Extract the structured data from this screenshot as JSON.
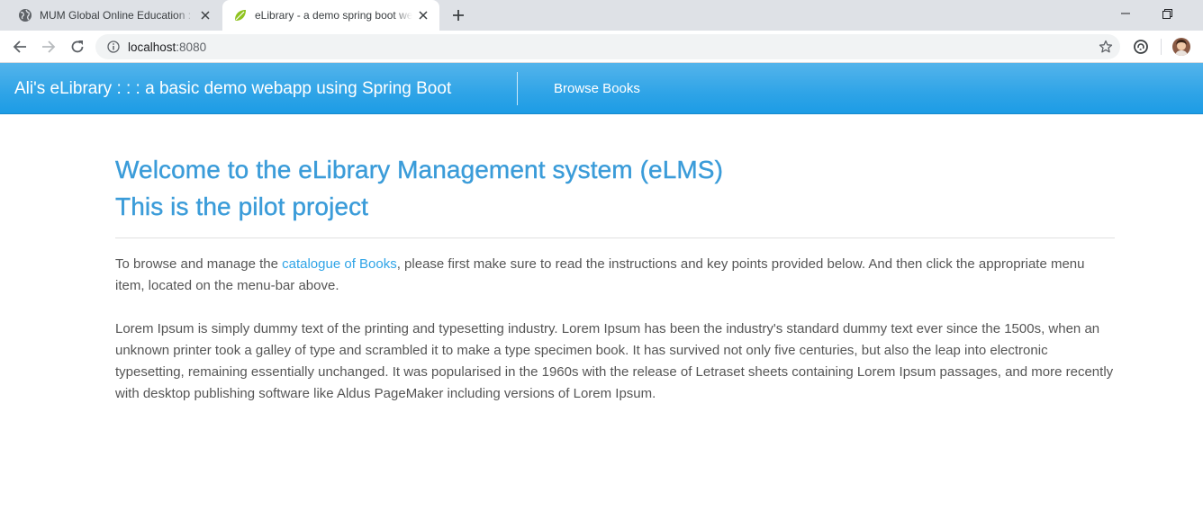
{
  "browser": {
    "tabs": [
      {
        "title": "MUM Global Online Education : C",
        "icon": "globe-icon",
        "active": false
      },
      {
        "title": "eLibrary - a demo spring boot we",
        "icon": "spring-leaf-icon",
        "active": true
      }
    ],
    "address": {
      "host": "localhost",
      "port": ":8080"
    }
  },
  "navbar": {
    "brand": "Ali's eLibrary : : : a basic demo webapp using Spring Boot",
    "links": [
      "Browse Books"
    ]
  },
  "main": {
    "heading_line1": "Welcome to the eLibrary Management system (eLMS)",
    "heading_line2": "This is the pilot project",
    "intro_before_link": "To browse and manage the ",
    "intro_link": "catalogue of Books",
    "intro_after_link": ", please first make sure to read the instructions and key points provided below. And then click the appropriate menu item, located on the menu-bar above.",
    "lorem": "Lorem Ipsum is simply dummy text of the printing and typesetting industry. Lorem Ipsum has been the industry's standard dummy text ever since the 1500s, when an unknown printer took a galley of type and scrambled it to make a type specimen book. It has survived not only five centuries, but also the leap into electronic typesetting, remaining essentially unchanged. It was popularised in the 1960s with the release of Letraset sheets containing Lorem Ipsum passages, and more recently with desktop publishing software like Aldus PageMaker including versions of Lorem Ipsum."
  },
  "colors": {
    "navbar": "#2fa4e7",
    "heading": "#3b9cd9",
    "link": "#2fa4e7",
    "body_text": "#555555",
    "tabstrip": "#dee1e6"
  }
}
